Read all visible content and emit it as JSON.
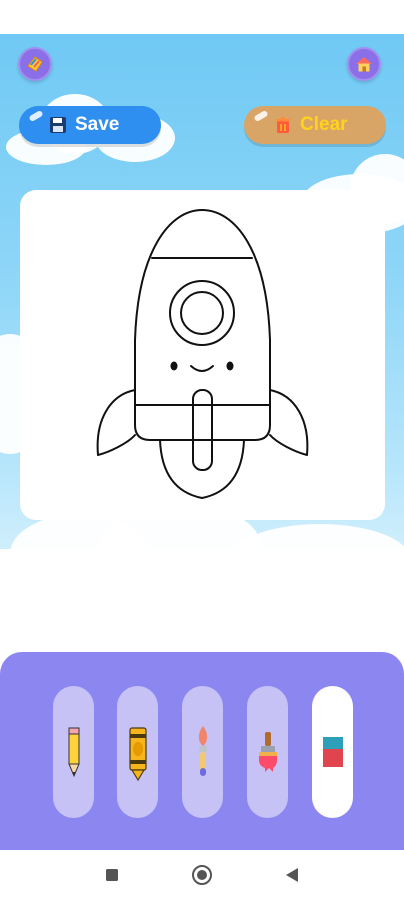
{
  "header": {
    "save_label": "Save",
    "clear_label": "Clear"
  },
  "icons": {
    "left_round_button": "palette-icon",
    "right_round_button": "home-icon",
    "save": "floppy-disk-icon",
    "clear": "trash-icon"
  },
  "canvas": {
    "drawing": "rocket-outline"
  },
  "toolbar": {
    "tools": [
      {
        "name": "pencil",
        "selected": false
      },
      {
        "name": "crayon",
        "selected": false
      },
      {
        "name": "paint-brush",
        "selected": false
      },
      {
        "name": "fill-brush",
        "selected": false
      },
      {
        "name": "eraser",
        "selected": true
      }
    ]
  },
  "colors": {
    "save_button": "#2f8ff0",
    "clear_button": "#d9a566",
    "clear_text": "#ffd21e",
    "toolbar_bg": "#8c86f1",
    "tool_slot": "#c6c2f6",
    "round_button": "#8a6fe8"
  },
  "nav": {
    "recents": "square-icon",
    "home": "circle-icon",
    "back": "triangle-back-icon"
  }
}
